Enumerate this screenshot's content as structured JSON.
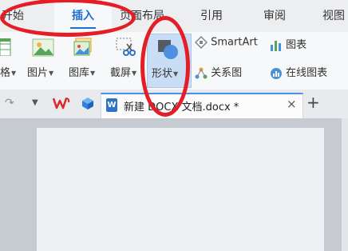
{
  "tabs": {
    "home": "开始",
    "insert": "插入",
    "page_layout": "页面布局",
    "references": "引用",
    "review": "审阅",
    "view": "视图"
  },
  "ribbon": {
    "table_partial": "格",
    "picture": "图片",
    "gallery": "图库",
    "screenshot": "截屏",
    "shape": "形状",
    "smartart": "SmartArt",
    "chart": "图表",
    "relation": "关系图",
    "online_chart": "在线图表"
  },
  "docbar": {
    "doc_title": "新建 DOCX 文档.docx *",
    "close": "×",
    "add": "+",
    "word_badge": "W"
  },
  "colors": {
    "accent": "#1f6fd1",
    "annotation_red": "#e41d26",
    "wps_red": "#d8282e"
  }
}
